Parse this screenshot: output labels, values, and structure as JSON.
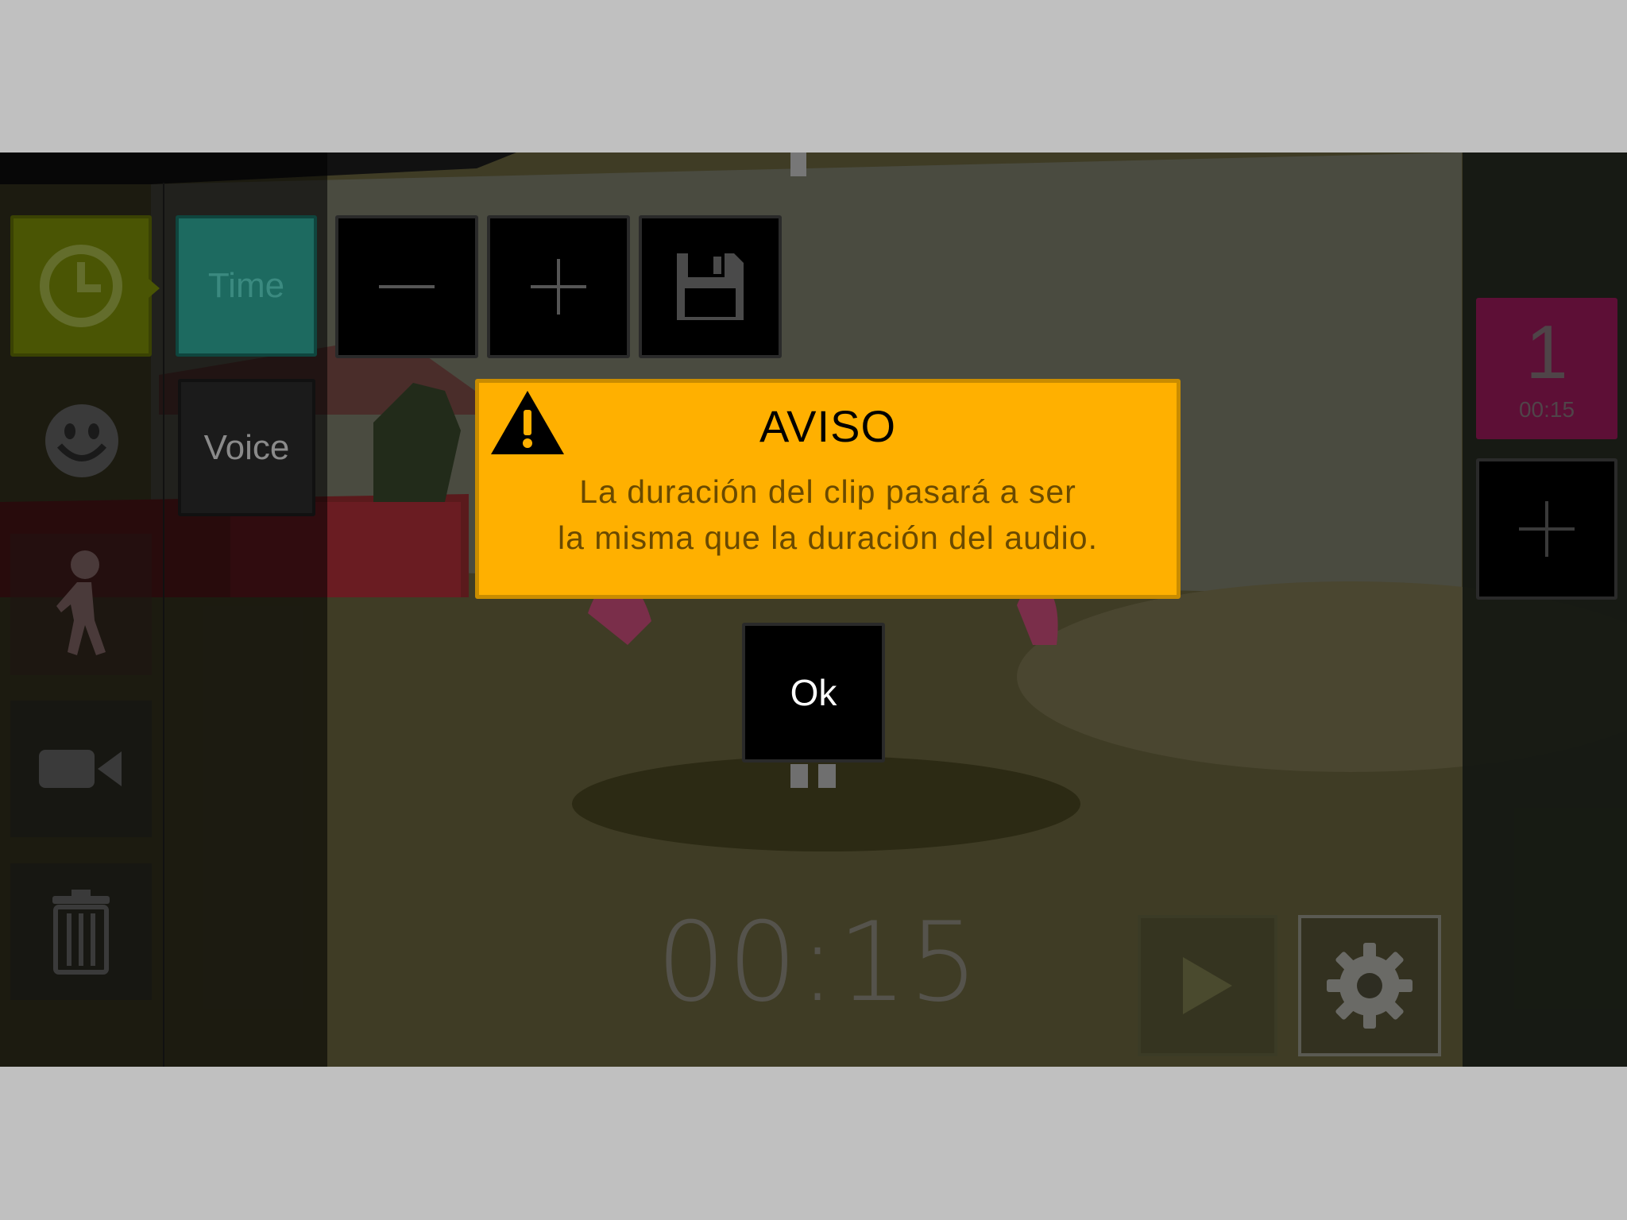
{
  "sidebar": {
    "tools": [
      {
        "name": "clock-icon"
      },
      {
        "name": "face-icon"
      },
      {
        "name": "walking-person-icon"
      },
      {
        "name": "video-camera-icon"
      },
      {
        "name": "trash-icon"
      }
    ]
  },
  "submenu": {
    "time_label": "Time",
    "voice_label": "Voice"
  },
  "toolbar": {
    "minus_icon": "minus-icon",
    "plus_icon": "plus-icon",
    "save_icon": "floppy-disk-icon"
  },
  "clips": {
    "items": [
      {
        "number": "1",
        "duration": "00:15"
      }
    ],
    "add_icon": "plus-icon"
  },
  "timer": {
    "value": "00:15"
  },
  "controls": {
    "play_icon": "play-icon",
    "settings_icon": "gear-icon"
  },
  "dialog": {
    "title": "AVISO",
    "message_line1": "La duración del clip pasará a ser",
    "message_line2": "la misma que la duración del audio.",
    "ok_label": "Ok",
    "icon": "warning-icon"
  },
  "colors": {
    "dialog_bg": "#ffb000",
    "clip_card": "#5d0f36",
    "time_button": "#1d6a60",
    "clock_tool": "#4a5504"
  }
}
